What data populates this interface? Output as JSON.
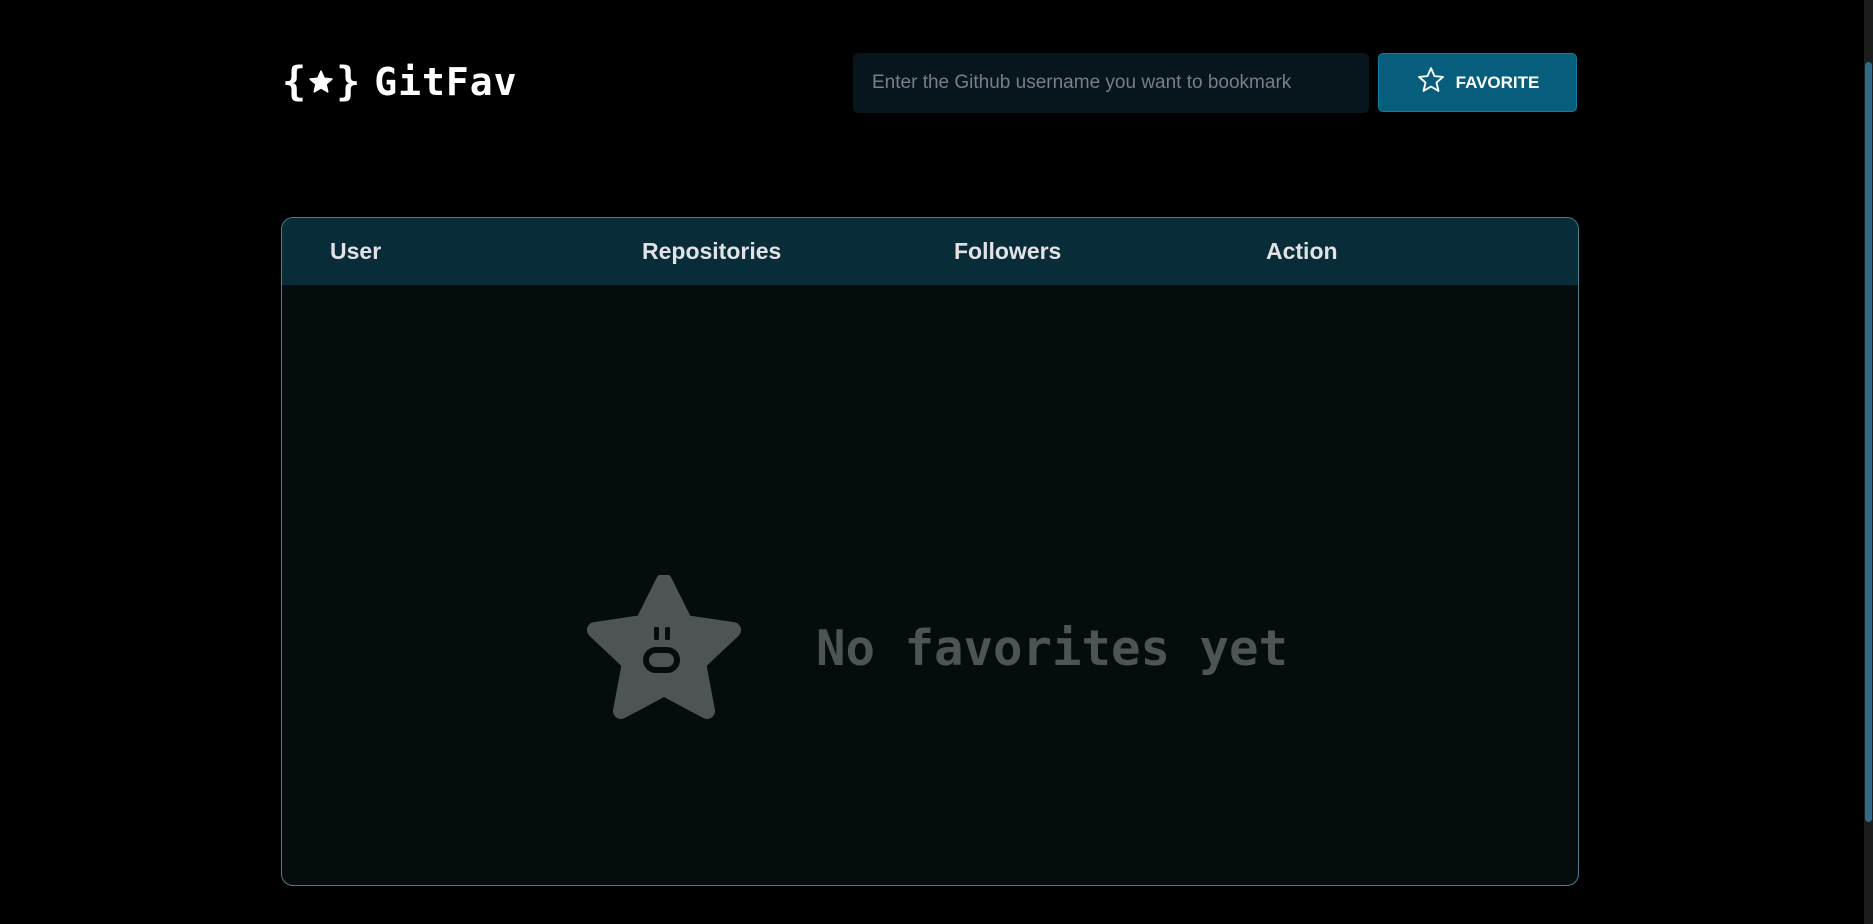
{
  "header": {
    "logo_text": "GitFav",
    "search_placeholder": "Enter the Github username you want to bookmark",
    "favorite_button_label": "FAVORITE"
  },
  "table": {
    "columns": [
      "User",
      "Repositories",
      "Followers",
      "Action"
    ],
    "rows": [],
    "empty_message": "No favorites yet"
  },
  "icons": {
    "logo": "braces-star-icon",
    "button": "star-outline-icon",
    "empty": "surprised-star-icon"
  },
  "colors": {
    "background": "#000000",
    "accent": "#065e7c",
    "table_header": "#092d38",
    "empty_text": "#4e5455"
  }
}
